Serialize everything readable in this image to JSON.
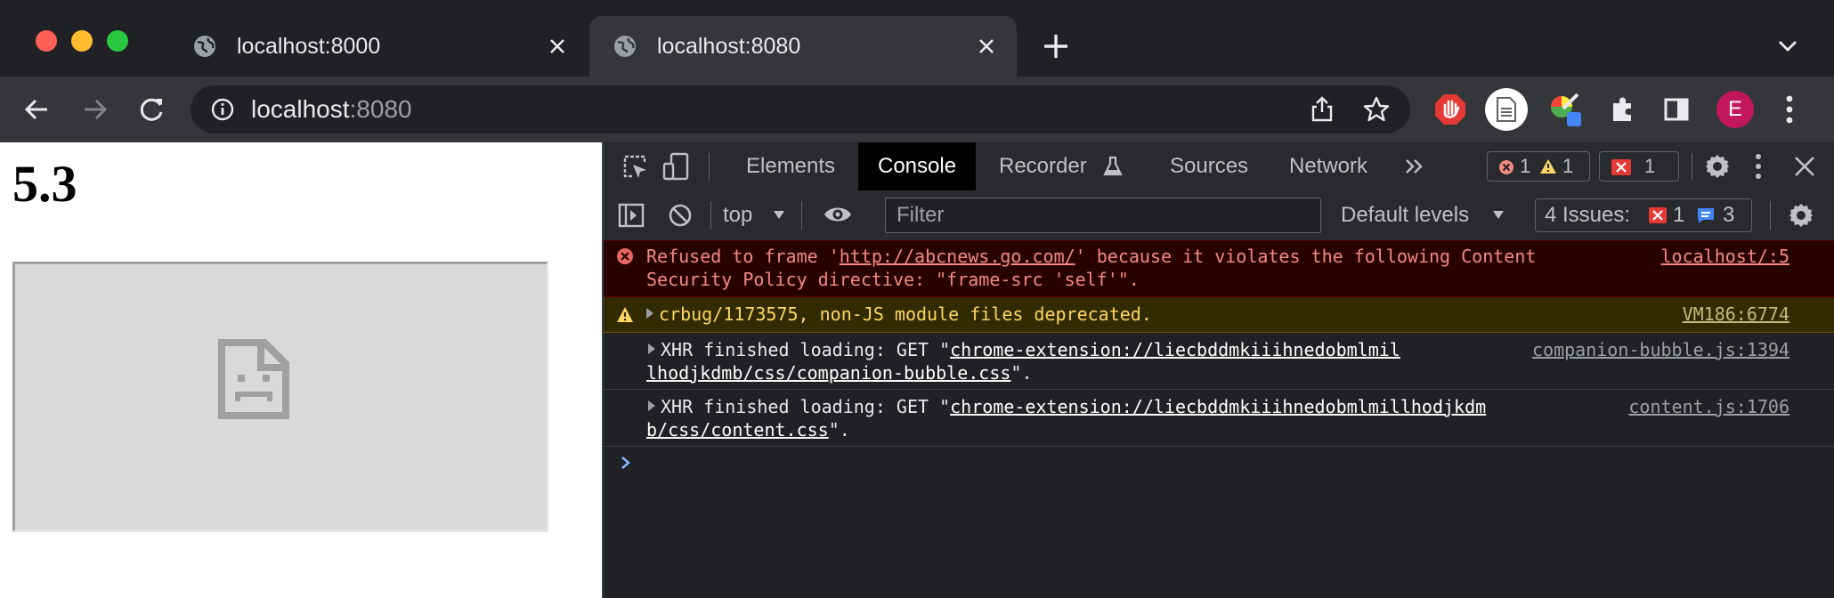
{
  "browser": {
    "tabs": [
      {
        "title": "localhost:8000",
        "active": false
      },
      {
        "title": "localhost:8080",
        "active": true
      }
    ],
    "address_bar": {
      "host": "localhost",
      "port": ":8080"
    },
    "profile_initial": "E"
  },
  "page": {
    "heading": "5.3"
  },
  "devtools": {
    "tabs": [
      {
        "label": "Elements"
      },
      {
        "label": "Console",
        "active": true
      },
      {
        "label": "Recorder"
      },
      {
        "label": "Sources"
      },
      {
        "label": "Network"
      }
    ],
    "counts": {
      "errors": "1",
      "warnings": "1",
      "issues_badge": "1"
    },
    "context": "top",
    "filter_placeholder": "Filter",
    "levels": "Default levels",
    "issues": {
      "label": "4 Issues:",
      "errors": "1",
      "info": "3"
    },
    "messages": {
      "error": {
        "pre": "Refused to frame '",
        "link": "http://abcnews.go.com/",
        "post": "' because it violates the following Content",
        "line2": "Security Policy directive: \"frame-src 'self'\".",
        "source": "localhost/:5"
      },
      "warning": {
        "text": "crbug/1173575, non-JS module files deprecated.",
        "source": "VM186:6774"
      },
      "info1": {
        "pre": "XHR finished loading: GET \"",
        "link1": "chrome-extension://liecbddmkiiihnedobmlmil",
        "link2": "lhodjkdmb/css/companion-bubble.css",
        "post": "\".",
        "source": "companion-bubble.js:1394"
      },
      "info2": {
        "pre": "XHR finished loading: GET \"",
        "link1": "chrome-extension://liecbddmkiiihnedobmlmillhodjkdm",
        "link2": "b/css/content.css",
        "post": "\".",
        "source": "content.js:1706"
      }
    }
  },
  "colors": {
    "error": "#f28b82",
    "warning": "#fdd663",
    "accent": "#8ab4f8"
  }
}
